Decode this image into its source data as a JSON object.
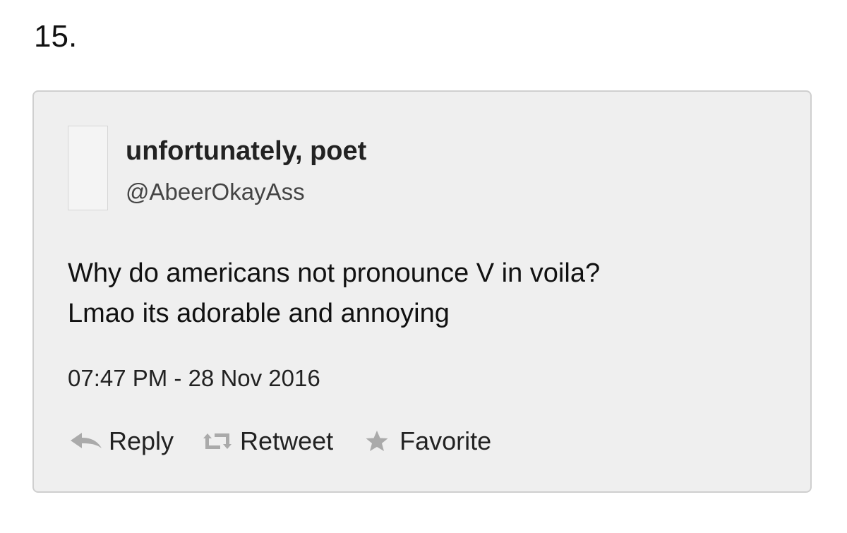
{
  "item_number": "15.",
  "tweet": {
    "display_name": "unfortunately, poet",
    "handle": "@AbeerOkayAss",
    "text_lines": [
      "Why do americans not pronounce V in voila?",
      "Lmao its adorable and annoying"
    ],
    "timestamp": "07:47 PM - 28 Nov 2016",
    "actions": {
      "reply": {
        "label": "Reply",
        "icon": "reply-icon"
      },
      "retweet": {
        "label": "Retweet",
        "icon": "retweet-icon"
      },
      "favorite": {
        "label": "Favorite",
        "icon": "star-icon"
      }
    }
  },
  "colors": {
    "card_background": "#efefef",
    "card_border": "#cfcfcf",
    "icon_gray": "#aaaaaa",
    "text": "#111111"
  }
}
